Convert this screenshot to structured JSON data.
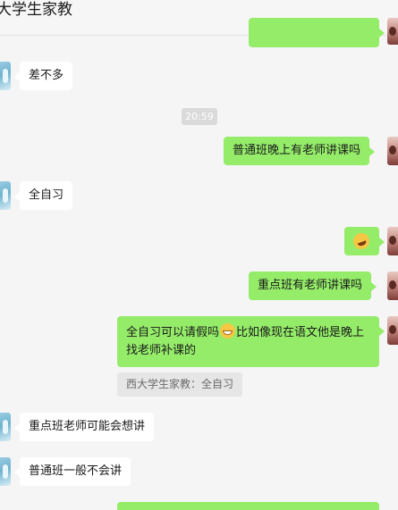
{
  "header": {
    "title": "大学生家教"
  },
  "messages": [
    {
      "text": "差不多"
    },
    {
      "text": "普通班晚上有老师讲课吗"
    },
    {
      "text": "全自习"
    },
    {
      "emoji": "grinning-sticker-emoji"
    },
    {
      "text": "重点班有老师讲课吗"
    },
    {
      "text_before": "全自习可以请假吗",
      "emoji": "grin-emoji",
      "text_after": "比如像现在语文他是晚上找老师补课的"
    },
    {
      "text": "重点班老师可能会想讲"
    },
    {
      "text": "普通班一般不会讲"
    }
  ],
  "timestamp": "20:59",
  "quote": "西大学生家教：全自习",
  "colors": {
    "sent_bubble": "#95ec69",
    "received_bubble": "#ffffff",
    "background": "#f5f5f5"
  }
}
